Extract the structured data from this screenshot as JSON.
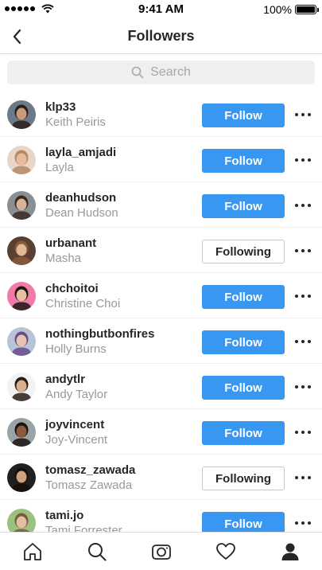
{
  "status_bar": {
    "time": "9:41 AM",
    "battery": "100%"
  },
  "header": {
    "title": "Followers"
  },
  "search": {
    "placeholder": "Search"
  },
  "followers": [
    {
      "username": "klp33",
      "full_name": "Keith Peiris",
      "button": "Follow",
      "state": "follow",
      "avatar_bg": "#6b7a88",
      "avatar_skin": "#c99b7a",
      "avatar_hair": "#2b1f18"
    },
    {
      "username": "layla_amjadi",
      "full_name": "Layla",
      "button": "Follow",
      "state": "follow",
      "avatar_bg": "#e8d6c8",
      "avatar_skin": "#e9b9a0",
      "avatar_hair": "#b58966"
    },
    {
      "username": "deanhudson",
      "full_name": "Dean Hudson",
      "button": "Follow",
      "state": "follow",
      "avatar_bg": "#8a8f93",
      "avatar_skin": "#d6b39a",
      "avatar_hair": "#3a2a22"
    },
    {
      "username": "urbanant",
      "full_name": "Masha",
      "button": "Following",
      "state": "following",
      "avatar_bg": "#5a4030",
      "avatar_skin": "#e2b898",
      "avatar_hair": "#8a5a3a"
    },
    {
      "username": "chchoitoi",
      "full_name": "Christine Choi",
      "button": "Follow",
      "state": "follow",
      "avatar_bg": "#f27aa8",
      "avatar_skin": "#e8c0a0",
      "avatar_hair": "#1e1410"
    },
    {
      "username": "nothingbutbonfires",
      "full_name": "Holly Burns",
      "button": "Follow",
      "state": "follow",
      "avatar_bg": "#b6c4d6",
      "avatar_skin": "#e6c4b0",
      "avatar_hair": "#6a4a8a"
    },
    {
      "username": "andytlr",
      "full_name": "Andy Taylor",
      "button": "Follow",
      "state": "follow",
      "avatar_bg": "#f3f3f3",
      "avatar_skin": "#dcb08e",
      "avatar_hair": "#2a1c14"
    },
    {
      "username": "joyvincent",
      "full_name": "Joy-Vincent",
      "button": "Follow",
      "state": "follow",
      "avatar_bg": "#9aa3a8",
      "avatar_skin": "#8a5a3e",
      "avatar_hair": "#1a120e"
    },
    {
      "username": "tomasz_zawada",
      "full_name": "Tomasz Zawada",
      "button": "Following",
      "state": "following",
      "avatar_bg": "#22201e",
      "avatar_skin": "#cfa280",
      "avatar_hair": "#15100c"
    },
    {
      "username": "tami.jo",
      "full_name": "Tami Forrester",
      "button": "Follow",
      "state": "follow",
      "avatar_bg": "#9cc080",
      "avatar_skin": "#e2bfa3",
      "avatar_hair": "#7a5a3a"
    }
  ],
  "tab_bar": {
    "tabs": [
      "home-icon",
      "search-icon",
      "camera-icon",
      "heart-icon",
      "profile-icon"
    ],
    "active": "profile-icon"
  },
  "colors": {
    "accent": "#3897f0",
    "text": "#262626",
    "muted": "#999999",
    "divider": "#efefef"
  }
}
